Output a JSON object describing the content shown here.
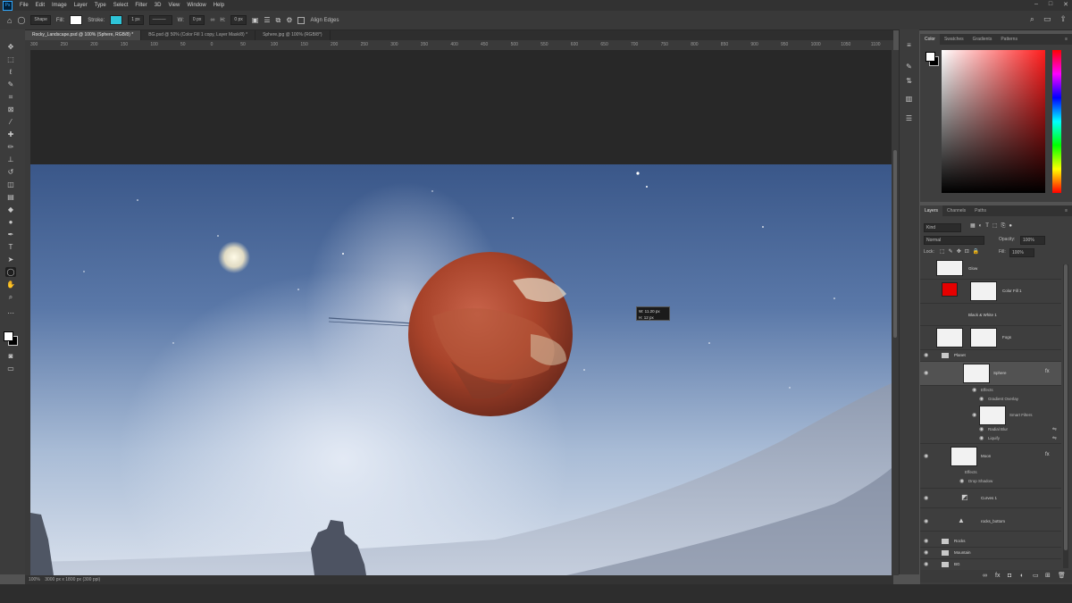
{
  "app": {
    "menu": [
      "File",
      "Edit",
      "Image",
      "Layer",
      "Type",
      "Select",
      "Filter",
      "3D",
      "View",
      "Window",
      "Help"
    ],
    "logo_label": "Ps"
  },
  "options": {
    "tool_mode": "Shape",
    "fill_label": "Fill:",
    "stroke_label": "Stroke:",
    "stroke_width": "1 px",
    "w_label": "W:",
    "w_value": "0 px",
    "h_label": "H:",
    "h_value": "0 px",
    "align_edges_label": "Align Edges"
  },
  "tabs": [
    {
      "label": "Rocky_Landscape.psd @ 100% (Sphere, RGB/8) *",
      "active": true
    },
    {
      "label": "BG.psd @ 50% (Color Fill 1 copy, Layer Mask/8) *",
      "active": false
    },
    {
      "label": "Sphere.jpg @ 100% (RGB/8*)",
      "active": false
    }
  ],
  "ruler_labels": [
    "300",
    "250",
    "200",
    "150",
    "100",
    "50",
    "0",
    "50",
    "100",
    "150",
    "200",
    "250",
    "300",
    "350",
    "400",
    "450",
    "500",
    "550",
    "600",
    "650",
    "700",
    "750",
    "800",
    "850",
    "900",
    "950",
    "1000",
    "1050",
    "1100"
  ],
  "measure": {
    "w": "W:  11.20 px",
    "h": "H:  12 px"
  },
  "status": {
    "zoom": "100%",
    "doc": "3000 px x 1800 px (300 ppi)"
  },
  "color_panel": {
    "tabs": [
      "Color",
      "Swatches",
      "Gradients",
      "Patterns"
    ],
    "active": "Color"
  },
  "layers_panel": {
    "tabs": [
      "Layers",
      "Channels",
      "Paths"
    ],
    "active": "Layers",
    "kind_filter": "Kind",
    "blend_mode": "Normal",
    "opacity_label": "Opacity:",
    "opacity_value": "100%",
    "lock_label": "Lock:",
    "fill_label": "Fill:",
    "fill_value": "100%",
    "layers": [
      {
        "name": "Glow",
        "type": "fill"
      },
      {
        "name": "Color Fill 1",
        "type": "fill"
      },
      {
        "name": "Black & White 1",
        "type": "adjustment"
      },
      {
        "name": "Fogs",
        "type": "mask"
      },
      {
        "name": "Planet",
        "type": "group"
      },
      {
        "name": "Sphere",
        "type": "smart",
        "selected": true
      },
      {
        "name": "Effects",
        "type": "effect"
      },
      {
        "name": "Gradient Overlay",
        "type": "effect"
      },
      {
        "name": "Smart Filters",
        "type": "smart-filter"
      },
      {
        "name": "Radial Blur",
        "type": "filter"
      },
      {
        "name": "Liquify",
        "type": "filter"
      },
      {
        "name": "Moon",
        "type": "smart"
      },
      {
        "name": "Effects",
        "type": "effect"
      },
      {
        "name": "Drop Shadow",
        "type": "effect"
      },
      {
        "name": "Curves 1",
        "type": "adjustment"
      },
      {
        "name": "rocks_bottom",
        "type": "layer"
      },
      {
        "name": "Rocks",
        "type": "group"
      },
      {
        "name": "Mountain",
        "type": "group"
      },
      {
        "name": "BG",
        "type": "group"
      }
    ]
  },
  "colors": {
    "accent": "#31a8ff",
    "planet": "#b04a2a",
    "fill_red": "#e60000"
  }
}
